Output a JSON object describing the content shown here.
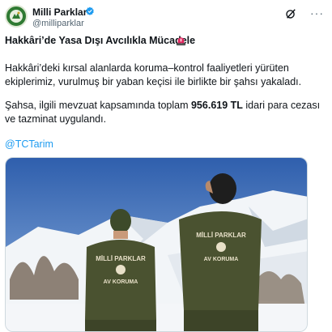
{
  "account": {
    "name": "Milli Parklar",
    "handle": "@milliparklar",
    "avatar_icon": "milli-parklar-logo",
    "verified_icon": "verified-badge-icon"
  },
  "header_icons": {
    "grok": "grok-icon",
    "more": "more-options-icon",
    "more_glyph": "···"
  },
  "tweet": {
    "title": "Hakkâri’de Yasa Dışı Avcılıkla Mücadele",
    "title_icon": "police-siren-emoji",
    "paragraph1": "Hakkâri’deki kırsal alanlarda koruma–kontrol faaliyetleri yürüten ekiplerimiz, vurulmuş bir yaban keçisi ile birlikte bir şahsı yakaladı.",
    "paragraph2_before": "Şahsa, ilgili mevzuat kapsamında toplam ",
    "paragraph2_amount": "956.619 TL",
    "paragraph2_after": " idari para cezası ve tazminat uygulandı.",
    "mention": "@TCTarim"
  },
  "media": {
    "description_icon": "photo-two-rangers-snowy-mountains",
    "patch_line1": "MİLLİ PARKLAR",
    "patch_line2": "AV KORUMA"
  },
  "colors": {
    "link": "#1d9bf0",
    "text": "#0f1419",
    "secondary": "#536471",
    "verified": "#1d9bf0",
    "sky": "#3f6fb8",
    "snow": "#eef2f6",
    "uniform": "#4a5230"
  }
}
